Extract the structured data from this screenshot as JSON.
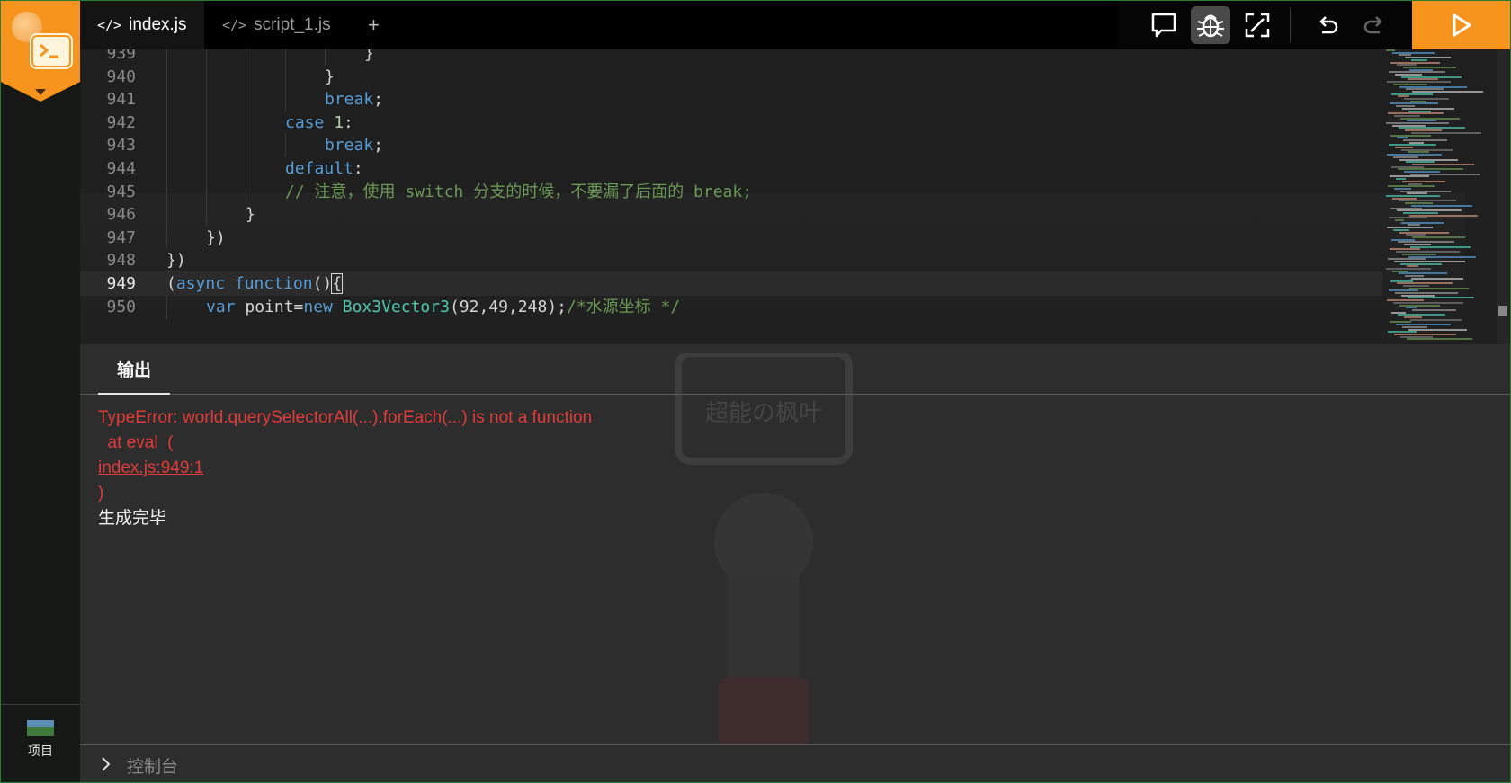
{
  "tabs": [
    {
      "icon": "code-icon",
      "label": "index.js",
      "active": true
    },
    {
      "icon": "code-icon",
      "label": "script_1.js",
      "active": false
    }
  ],
  "add_tab_label": "+",
  "toolbar": {
    "tools": [
      "comment-icon",
      "debug-icon",
      "expand-icon",
      "undo-icon",
      "redo-icon"
    ],
    "active_tool": "debug-icon",
    "run": "play-icon"
  },
  "editor": {
    "current_line": 949,
    "lines": [
      {
        "num": "939",
        "segments": [
          {
            "t": "}",
            "c": "p"
          }
        ]
      },
      {
        "num": "940",
        "segments": [
          {
            "t": "}",
            "c": "p"
          }
        ]
      },
      {
        "num": "941",
        "segments": [
          {
            "t": "break",
            "c": "kw"
          },
          {
            "t": ";",
            "c": "p"
          }
        ]
      },
      {
        "num": "942",
        "segments": [
          {
            "t": "case",
            "c": "kw"
          },
          {
            "t": " ",
            "c": "p"
          },
          {
            "t": "1",
            "c": "num"
          },
          {
            "t": ":",
            "c": "p"
          }
        ]
      },
      {
        "num": "943",
        "segments": [
          {
            "t": "break",
            "c": "kw"
          },
          {
            "t": ";",
            "c": "p"
          }
        ]
      },
      {
        "num": "944",
        "segments": [
          {
            "t": "default",
            "c": "kw"
          },
          {
            "t": ":",
            "c": "p"
          }
        ]
      },
      {
        "num": "945",
        "segments": [
          {
            "t": "// 注意，使用 switch 分支的时候，不要漏了后面的 break;",
            "c": "cmt"
          }
        ]
      },
      {
        "num": "946",
        "segments": [
          {
            "t": "}",
            "c": "p"
          }
        ]
      },
      {
        "num": "947",
        "segments": [
          {
            "t": "})",
            "c": "p"
          }
        ]
      },
      {
        "num": "948",
        "segments": [
          {
            "t": "})",
            "c": "p"
          }
        ]
      },
      {
        "num": "949",
        "segments": [
          {
            "t": "(",
            "c": "p"
          },
          {
            "t": "async",
            "c": "kw"
          },
          {
            "t": " ",
            "c": "p"
          },
          {
            "t": "function",
            "c": "kw"
          },
          {
            "t": "()",
            "c": "p"
          },
          {
            "t": "{",
            "c": "cursor"
          }
        ]
      },
      {
        "num": "950",
        "segments": [
          {
            "t": "var",
            "c": "kw"
          },
          {
            "t": " point=",
            "c": "p"
          },
          {
            "t": "new",
            "c": "kw"
          },
          {
            "t": " ",
            "c": "p"
          },
          {
            "t": "Box3Vector3",
            "c": "cls"
          },
          {
            "t": "(92,49,248);",
            "c": "p"
          },
          {
            "t": "/*水源坐标 */",
            "c": "cmt"
          }
        ]
      }
    ]
  },
  "output": {
    "tab_label": "输出",
    "error_message": "TypeError: world.querySelectorAll(...).forEach(...) is not a function",
    "error_at": "  at eval  (",
    "error_link": "index.js:949:1",
    "error_close": ")",
    "done_message": "生成完毕"
  },
  "sidebar": {
    "project_label": "项目"
  },
  "console": {
    "label": "控制台"
  },
  "watermark_text": "超能の枫叶",
  "colors": {
    "accent": "#f7941d",
    "error": "#e23b3b",
    "keyword": "#569cd6",
    "class": "#4ec9b0",
    "comment": "#6a9955"
  }
}
